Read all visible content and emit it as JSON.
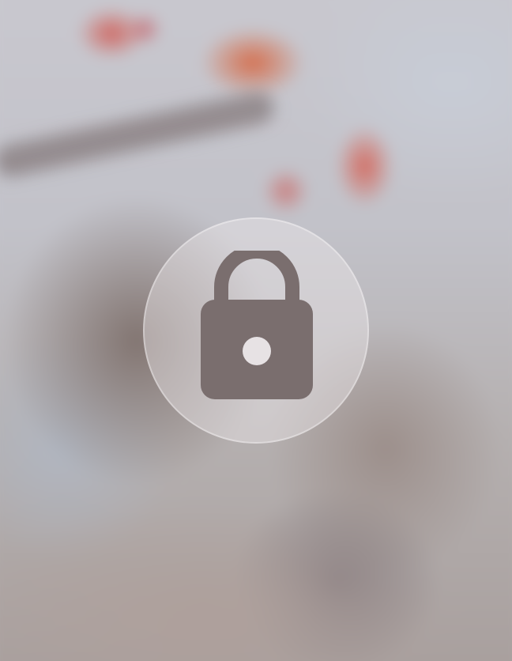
{
  "lock_screen": {
    "state": "locked",
    "background": "blurred-photo",
    "center_icon": "lock-icon",
    "colors": {
      "icon": "#7a6e6e",
      "circle": "#ece8ea"
    }
  }
}
